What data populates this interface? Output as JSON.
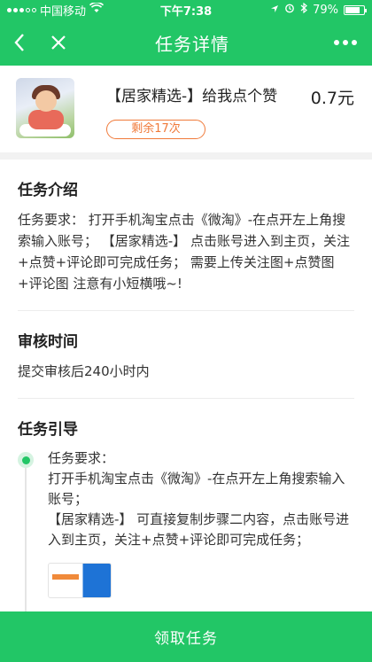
{
  "status_bar": {
    "carrier": "中国移动",
    "time": "下午7:38",
    "battery": "79%",
    "battery_level": 0.79
  },
  "nav": {
    "title": "任务详情"
  },
  "task": {
    "title": "【居家精选-】给我点个赞",
    "price": "0.7元",
    "remaining": "剩余17次"
  },
  "intro": {
    "title": "任务介绍",
    "text": "任务要求： 打开手机淘宝点击《微淘》-在点开左上角搜索输入账号； 【居家精选-】 点击账号进入到主页，关注+点赞+评论即可完成任务； 需要上传关注图+点赞图+评论图 注意有小短横哦~!"
  },
  "review": {
    "title": "审核时间",
    "text": "提交审核后240小时内"
  },
  "guide": {
    "title": "任务引导",
    "step_heading": "任务要求：",
    "step_text": "打开手机淘宝点击《微淘》-在点开左上角搜索输入账号；",
    "step_text_2": "【居家精选-】 可直接复制步骤二内容，点击账号进入到主页，关注+点赞+评论即可完成任务；"
  },
  "bottom": {
    "button_label": "领取任务"
  }
}
